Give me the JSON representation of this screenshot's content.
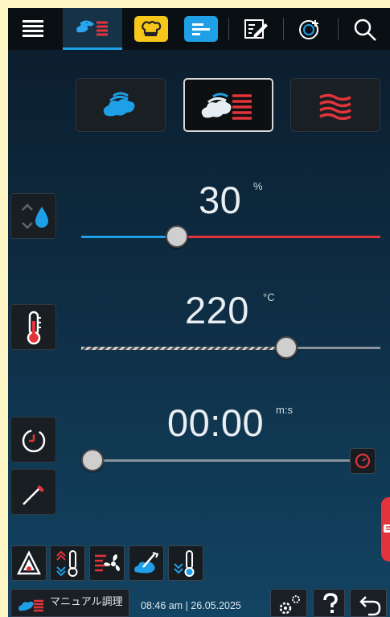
{
  "tabs": [
    {
      "id": "menu",
      "icon": "menu-icon"
    },
    {
      "id": "manual-combi",
      "icon": "combi-steam-heat-icon",
      "active": true
    },
    {
      "id": "chef-hat",
      "icon": "chef-hat-icon"
    },
    {
      "id": "programs",
      "icon": "program-list-icon"
    },
    {
      "id": "edit",
      "icon": "edit-icon"
    },
    {
      "id": "favorites",
      "icon": "globe-plus-icon"
    },
    {
      "id": "search",
      "icon": "search-icon"
    }
  ],
  "modes": [
    {
      "name": "steam",
      "icon": "steam-icon"
    },
    {
      "name": "combi",
      "icon": "combi-steam-heat-icon",
      "selected": true
    },
    {
      "name": "hot-air",
      "icon": "heat-waves-icon"
    }
  ],
  "humidity": {
    "value": "30",
    "unit": "%",
    "level": 0.3
  },
  "temperature": {
    "value": "220",
    "unit": "°C",
    "level": 0.68
  },
  "time": {
    "value": "00:00",
    "unit": "m:s",
    "level": 0.0
  },
  "bottom_tools": [
    "delta-t-icon",
    "core-temp-icon",
    "fan-speed-icon",
    "cleaning-steam-icon",
    "cool-down-icon"
  ],
  "footer": {
    "mode_label": "マニュアル調理",
    "datetime": "08:46 am | 26.05.2025"
  },
  "colors": {
    "accent_blue": "#1ea0e6",
    "accent_red": "#e3343b",
    "tab_yellow": "#f6c619"
  }
}
